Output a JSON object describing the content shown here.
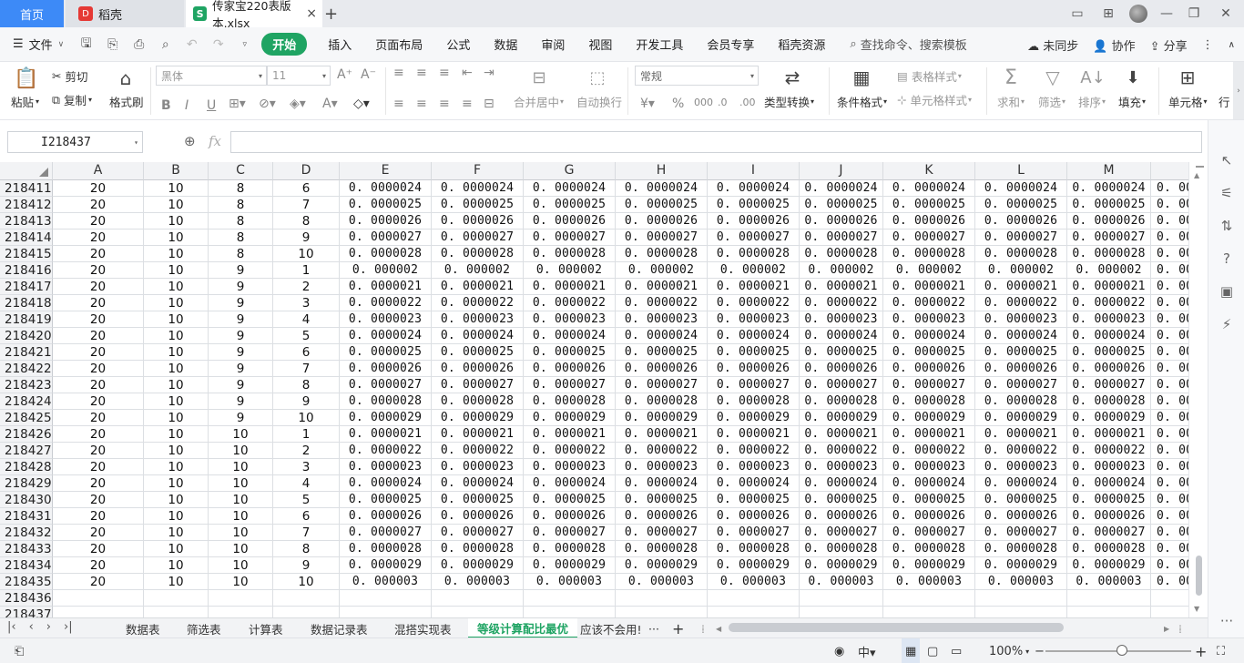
{
  "titlebar": {
    "home_label": "首页",
    "daoke_label": "稻壳",
    "file_tab_label": "传家宝220表版本.xlsx",
    "close_glyph": "×",
    "add_glyph": "+"
  },
  "menubar": {
    "file_label": "文件",
    "tabs": [
      "开始",
      "插入",
      "页面布局",
      "公式",
      "数据",
      "审阅",
      "视图",
      "开发工具",
      "会员专享",
      "稻壳资源"
    ],
    "search_label": "查找命令、搜索模板",
    "sync_label": "未同步",
    "collab_label": "协作",
    "share_label": "分享"
  },
  "ribbon": {
    "paste": "粘贴",
    "cut": "剪切",
    "copy": "复制",
    "format_painter": "格式刷",
    "font_name": "黑体",
    "font_size": "11",
    "merge_center": "合并居中",
    "wrap_text": "自动换行",
    "number_format": "常规",
    "type_convert": "类型转换",
    "cond_format": "条件格式",
    "table_style": "表格样式",
    "cell_style": "单元格样式",
    "sum": "求和",
    "filter": "筛选",
    "sort": "排序",
    "fill": "填充",
    "cells": "单元格",
    "rows_cols": "行"
  },
  "formulabar": {
    "name_box": "I218437",
    "fx": "fx",
    "formula": ""
  },
  "grid": {
    "columns": [
      "A",
      "B",
      "C",
      "D",
      "E",
      "F",
      "G",
      "H",
      "I",
      "J",
      "K",
      "L",
      "M"
    ],
    "rows": [
      {
        "n": "218411",
        "a": "20",
        "b": "10",
        "c": "8",
        "d": "6",
        "v": "0.0000024"
      },
      {
        "n": "218412",
        "a": "20",
        "b": "10",
        "c": "8",
        "d": "7",
        "v": "0.0000025"
      },
      {
        "n": "218413",
        "a": "20",
        "b": "10",
        "c": "8",
        "d": "8",
        "v": "0.0000026"
      },
      {
        "n": "218414",
        "a": "20",
        "b": "10",
        "c": "8",
        "d": "9",
        "v": "0.0000027"
      },
      {
        "n": "218415",
        "a": "20",
        "b": "10",
        "c": "8",
        "d": "10",
        "v": "0.0000028"
      },
      {
        "n": "218416",
        "a": "20",
        "b": "10",
        "c": "9",
        "d": "1",
        "v": "0.000002"
      },
      {
        "n": "218417",
        "a": "20",
        "b": "10",
        "c": "9",
        "d": "2",
        "v": "0.0000021"
      },
      {
        "n": "218418",
        "a": "20",
        "b": "10",
        "c": "9",
        "d": "3",
        "v": "0.0000022"
      },
      {
        "n": "218419",
        "a": "20",
        "b": "10",
        "c": "9",
        "d": "4",
        "v": "0.0000023"
      },
      {
        "n": "218420",
        "a": "20",
        "b": "10",
        "c": "9",
        "d": "5",
        "v": "0.0000024"
      },
      {
        "n": "218421",
        "a": "20",
        "b": "10",
        "c": "9",
        "d": "6",
        "v": "0.0000025"
      },
      {
        "n": "218422",
        "a": "20",
        "b": "10",
        "c": "9",
        "d": "7",
        "v": "0.0000026"
      },
      {
        "n": "218423",
        "a": "20",
        "b": "10",
        "c": "9",
        "d": "8",
        "v": "0.0000027"
      },
      {
        "n": "218424",
        "a": "20",
        "b": "10",
        "c": "9",
        "d": "9",
        "v": "0.0000028"
      },
      {
        "n": "218425",
        "a": "20",
        "b": "10",
        "c": "9",
        "d": "10",
        "v": "0.0000029"
      },
      {
        "n": "218426",
        "a": "20",
        "b": "10",
        "c": "10",
        "d": "1",
        "v": "0.0000021"
      },
      {
        "n": "218427",
        "a": "20",
        "b": "10",
        "c": "10",
        "d": "2",
        "v": "0.0000022"
      },
      {
        "n": "218428",
        "a": "20",
        "b": "10",
        "c": "10",
        "d": "3",
        "v": "0.0000023"
      },
      {
        "n": "218429",
        "a": "20",
        "b": "10",
        "c": "10",
        "d": "4",
        "v": "0.0000024"
      },
      {
        "n": "218430",
        "a": "20",
        "b": "10",
        "c": "10",
        "d": "5",
        "v": "0.0000025"
      },
      {
        "n": "218431",
        "a": "20",
        "b": "10",
        "c": "10",
        "d": "6",
        "v": "0.0000026"
      },
      {
        "n": "218432",
        "a": "20",
        "b": "10",
        "c": "10",
        "d": "7",
        "v": "0.0000027"
      },
      {
        "n": "218433",
        "a": "20",
        "b": "10",
        "c": "10",
        "d": "8",
        "v": "0.0000028"
      },
      {
        "n": "218434",
        "a": "20",
        "b": "10",
        "c": "10",
        "d": "9",
        "v": "0.0000029"
      },
      {
        "n": "218435",
        "a": "20",
        "b": "10",
        "c": "10",
        "d": "10",
        "v": "0.000003"
      },
      {
        "n": "218436",
        "a": "",
        "b": "",
        "c": "",
        "d": "",
        "v": ""
      },
      {
        "n": "218437",
        "a": "",
        "b": "",
        "c": "",
        "d": "",
        "v": ""
      }
    ]
  },
  "sheets": {
    "tabs": [
      "数据表",
      "筛选表",
      "计算表",
      "数据记录表",
      "混搭实现表",
      "等级计算配比最优",
      "应该不会用!"
    ],
    "active": "等级计算配比最优",
    "more": "···"
  },
  "statusbar": {
    "zoom": "100%"
  },
  "colors": {
    "accent": "#1fa463",
    "home_tab": "#3d8af7"
  }
}
